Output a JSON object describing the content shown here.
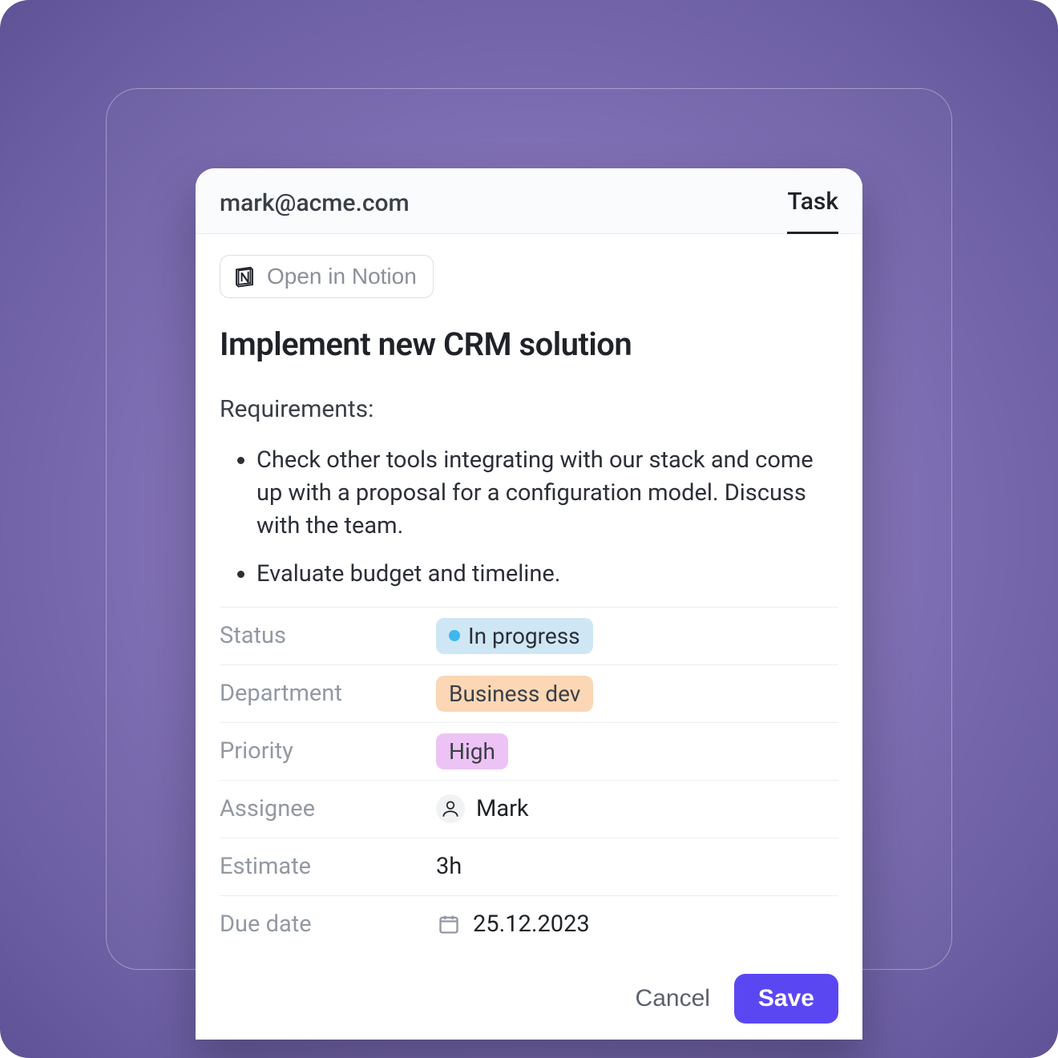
{
  "header": {
    "email": "mark@acme.com",
    "tab": "Task"
  },
  "open_notion_label": "Open in Notion",
  "task": {
    "title": "Implement new CRM solution",
    "requirements_label": "Requirements:",
    "requirements": [
      "Check other tools integrating with our stack and come up with a proposal for a configuration model. Discuss with the team.",
      "Evaluate budget and timeline."
    ]
  },
  "props": {
    "status": {
      "label": "Status",
      "value": "In progress"
    },
    "department": {
      "label": "Department",
      "value": "Business dev"
    },
    "priority": {
      "label": "Priority",
      "value": "High"
    },
    "assignee": {
      "label": "Assignee",
      "value": "Mark"
    },
    "estimate": {
      "label": "Estimate",
      "value": "3h"
    },
    "due_date": {
      "label": "Due date",
      "value": "25.12.2023"
    }
  },
  "footer": {
    "cancel": "Cancel",
    "save": "Save"
  }
}
